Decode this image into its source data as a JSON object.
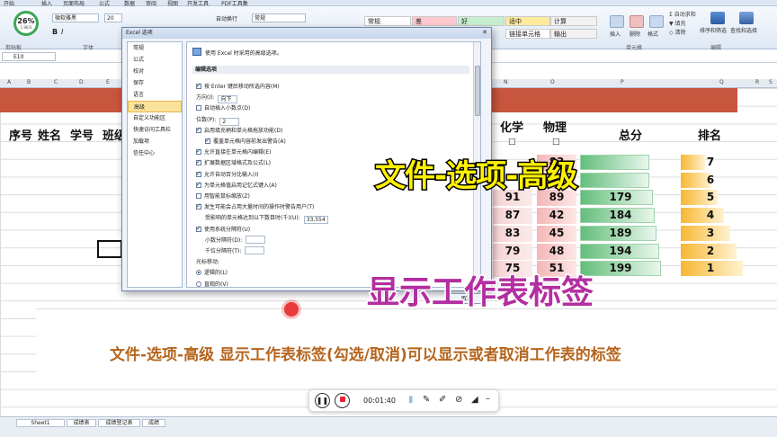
{
  "ribbon": {
    "tabs": [
      "开始",
      "插入",
      "页面布局",
      "公式",
      "数据",
      "审阅",
      "视图",
      "开发工具",
      "PDF工具集"
    ],
    "font_name": "微软雅黑",
    "font_size": "20",
    "wrap_label": "自动换行",
    "format_label": "常规",
    "styles": [
      {
        "label": "常规",
        "bg": "#ffffff"
      },
      {
        "label": "差",
        "bg": "#ffc7ce"
      },
      {
        "label": "好",
        "bg": "#c6efce"
      },
      {
        "label": "适中",
        "bg": "#ffeb9c"
      },
      {
        "label": "计算",
        "bg": "#f2f2f2"
      },
      {
        "label": "链接单元格",
        "bg": "#ffffff"
      },
      {
        "label": "输出",
        "bg": "#f2f2f2"
      }
    ],
    "cells_insert": "插入",
    "cells_delete": "删除",
    "cells_format": "格式",
    "autosum": "自动求和",
    "fill": "填充",
    "clear": "清除",
    "sort": "排序和筛选",
    "find": "查找和选择",
    "groups": [
      "剪贴板",
      "字体",
      "单元格",
      "编辑"
    ],
    "zoom": "26%",
    "speed": "1.8K/S"
  },
  "formula": {
    "name_box": "E10"
  },
  "columns": [
    "A",
    "B",
    "C",
    "D",
    "E",
    "N",
    "O",
    "P",
    "Q",
    "R",
    "S"
  ],
  "headers": {
    "seq": "序号",
    "name": "姓名",
    "student_id": "学号",
    "class": "班级",
    "chemistry": "化学",
    "physics": "物理",
    "total": "总分",
    "rank": "排名"
  },
  "checkbox_glyph": "□",
  "rows": [
    {
      "chem": "",
      "phys": "83",
      "total": "",
      "rank": "7"
    },
    {
      "chem": "",
      "phys": "",
      "total": "",
      "rank": "6"
    },
    {
      "chem": "91",
      "phys": "89",
      "total": "179",
      "rank": "5"
    },
    {
      "chem": "87",
      "phys": "42",
      "total": "184",
      "rank": "4"
    },
    {
      "chem": "83",
      "phys": "45",
      "total": "189",
      "rank": "3"
    },
    {
      "chem": "79",
      "phys": "48",
      "total": "194",
      "rank": "2"
    },
    {
      "chem": "75",
      "phys": "51",
      "total": "199",
      "rank": "1"
    }
  ],
  "dialog": {
    "title": "Excel 选项",
    "nav": [
      "常规",
      "公式",
      "校对",
      "保存",
      "语言",
      "高级",
      "自定义功能区",
      "快速访问工具栏",
      "加载项",
      "信任中心"
    ],
    "selected_index": 5,
    "intro": "使用 Excel 时采用的高级选项。",
    "section": "编辑选项",
    "options": [
      {
        "label": "按 Enter 键后移动所选内容(M)",
        "checked": true
      },
      {
        "label": "方向(I):",
        "control": "向下"
      },
      {
        "label": "自动插入小数点(D)",
        "checked": false
      },
      {
        "label": "位数(P):",
        "control": "2"
      },
      {
        "label": "启用填充柄和单元格拖放功能(D)",
        "checked": true
      },
      {
        "label": "覆盖单元格内容前发出警告(A)",
        "checked": true,
        "indent": true
      },
      {
        "label": "允许直接在单元格内编辑(E)",
        "checked": true
      },
      {
        "label": "扩展数据区域格式及公式(L)",
        "checked": true
      },
      {
        "label": "允许自动百分比输入(I)",
        "checked": true
      },
      {
        "label": "为单元格值启用记忆式键入(A)",
        "checked": true
      },
      {
        "label": "用智能鼠标缩放(Z)",
        "checked": false
      },
      {
        "label": "发生可能会占用大量时间的操作时警告用户(T)",
        "checked": true
      },
      {
        "label": "受影响的单元格达到以下数目时(千)(U):",
        "control": "33,554",
        "indent": true
      },
      {
        "label": "使用系统分隔符(U)",
        "checked": true
      },
      {
        "label": "小数分隔符(D):",
        "control": "",
        "indent": true
      },
      {
        "label": "千位分隔符(T):",
        "control": "",
        "indent": true
      },
      {
        "label": "光标移动:",
        "type": "heading"
      },
      {
        "label": "逻辑的(L)",
        "radio": true,
        "checked": true
      },
      {
        "label": "直观的(V)",
        "radio": true,
        "checked": false
      }
    ],
    "cancel": "取消"
  },
  "overlay": {
    "title": "文件-选项-高级",
    "subtitle": "显示工作表标签",
    "caption": "文件-选项-高级 显示工作表标签(勾选/取消)可以显示或者取消工作表的标签"
  },
  "player": {
    "time": "00:01:40"
  },
  "sheets": [
    "Sheet1",
    "成绩表",
    "成绩登记表",
    "成绩"
  ]
}
